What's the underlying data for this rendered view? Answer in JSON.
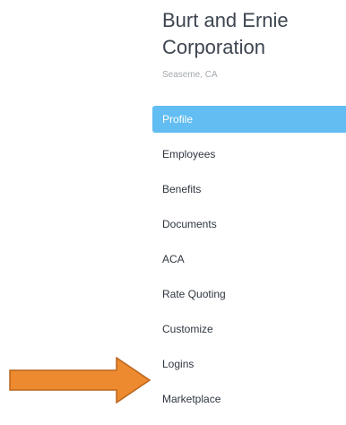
{
  "company": {
    "name": "Burt and Ernie Corporation",
    "location": "Seaseme, CA"
  },
  "nav": {
    "items": [
      {
        "label": "Profile",
        "active": true
      },
      {
        "label": "Employees",
        "active": false
      },
      {
        "label": "Benefits",
        "active": false
      },
      {
        "label": "Documents",
        "active": false
      },
      {
        "label": "ACA",
        "active": false
      },
      {
        "label": "Rate Quoting",
        "active": false
      },
      {
        "label": "Customize",
        "active": false
      },
      {
        "label": "Logins",
        "active": false
      },
      {
        "label": "Marketplace",
        "active": false
      }
    ]
  },
  "colors": {
    "active_background": "#62bdf2",
    "arrow_fill": "#ed8a2f",
    "arrow_stroke": "#b9661e"
  },
  "annotation": {
    "icon": "arrow-right-icon"
  }
}
